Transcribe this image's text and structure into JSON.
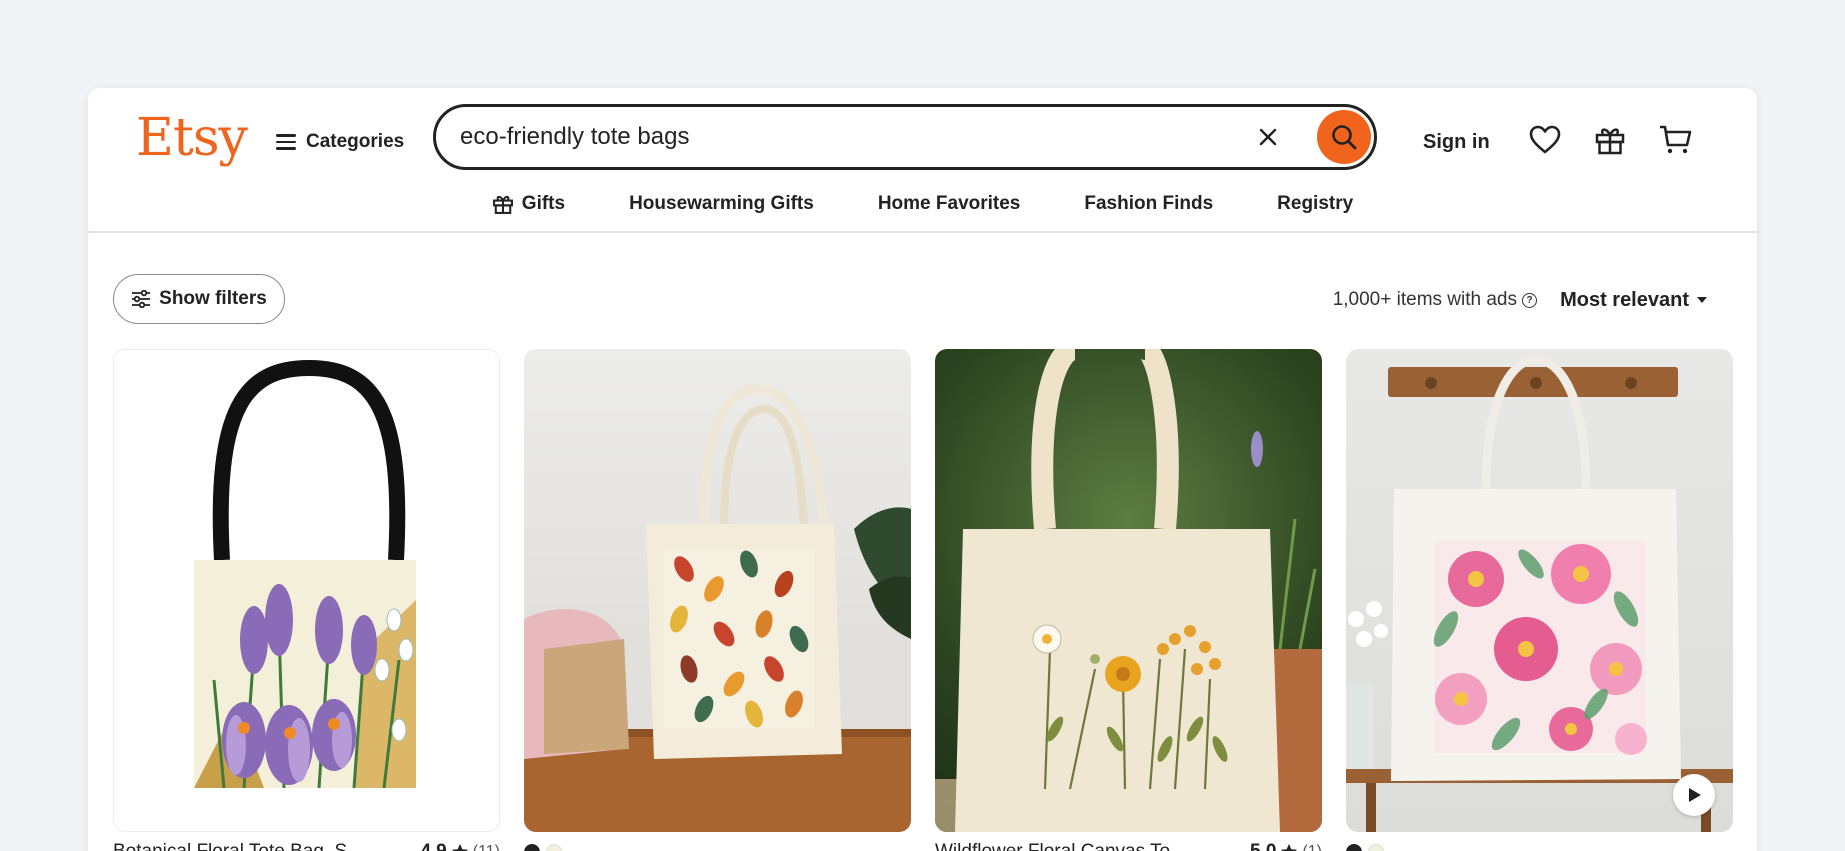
{
  "header": {
    "logo": "Etsy",
    "categories_label": "Categories",
    "search_value": "eco-friendly tote bags",
    "sign_in_label": "Sign in"
  },
  "subnav": {
    "items": [
      "Gifts",
      "Housewarming Gifts",
      "Home Favorites",
      "Fashion Finds",
      "Registry"
    ]
  },
  "toolbar": {
    "filters_label": "Show filters",
    "results_text": "1,000+ items with ads",
    "sort_label": "Most relevant"
  },
  "listings": [
    {
      "title": "Botanical Floral Tote Bag, S",
      "rating": "4.9",
      "count": "(11)"
    },
    {
      "swatches": [
        "#222222",
        "#f3f1dc"
      ]
    },
    {
      "title": "Wildflower Floral Canvas To",
      "rating": "5.0",
      "count": "(1)"
    },
    {
      "swatches": [
        "#222222",
        "#f3f1dc"
      ]
    }
  ],
  "colors": {
    "brand": "#f1641e",
    "text": "#222222",
    "page_background": "#f2f3f7"
  },
  "icons": [
    "hamburger-icon",
    "close-icon",
    "search-icon",
    "heart-icon",
    "gift-icon",
    "cart-icon",
    "filter-icon",
    "info-icon",
    "star-icon",
    "play-icon"
  ]
}
